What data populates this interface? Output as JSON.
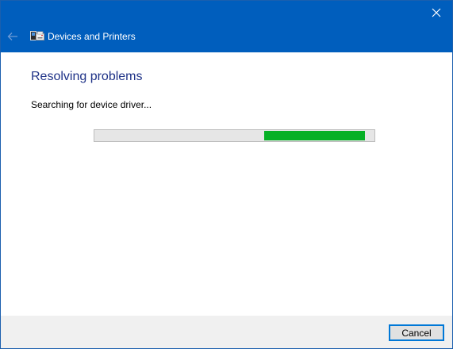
{
  "window": {
    "title": "Devices and Printers",
    "back_icon": "arrow-left-icon",
    "close_icon": "close-icon",
    "app_icon": "devices-printers-icon",
    "titlebar_color": "#005ebd"
  },
  "main": {
    "heading": "Resolving problems",
    "status_text": "Searching for device driver...",
    "progress": {
      "type": "indeterminate",
      "fill_color": "#06b025",
      "track_color": "#e6e6e6"
    }
  },
  "footer": {
    "cancel_label": "Cancel"
  }
}
